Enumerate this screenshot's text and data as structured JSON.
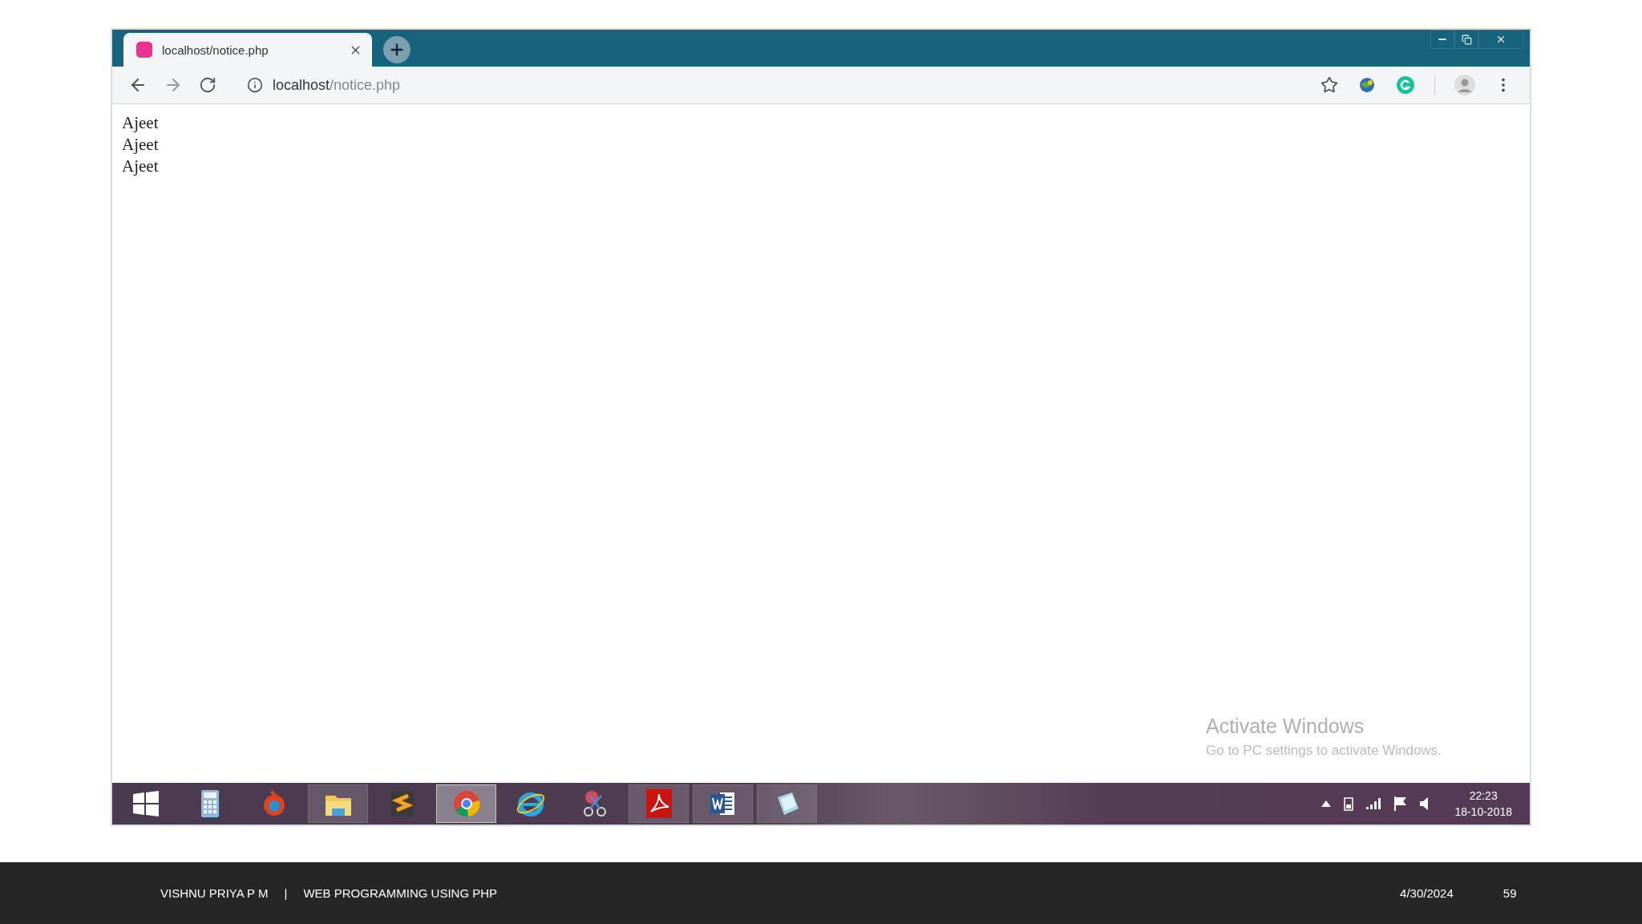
{
  "browser": {
    "tabs": [
      {
        "title": "localhost/notice.php",
        "selected": true
      }
    ],
    "address": {
      "host": "localhost",
      "path": "/notice.php"
    },
    "content_lines": [
      "Ajeet",
      "Ajeet",
      "Ajeet"
    ]
  },
  "activation_notice": {
    "title": "Activate Windows",
    "message": "Go to PC settings to activate Windows."
  },
  "taskbar": {
    "apps": [
      {
        "kind": "start",
        "open": false,
        "selected": false
      },
      {
        "kind": "calculator",
        "open": false,
        "selected": false
      },
      {
        "kind": "firefox",
        "open": false,
        "selected": false
      },
      {
        "kind": "explorer",
        "open": true,
        "selected": false
      },
      {
        "kind": "sublime",
        "open": false,
        "selected": false
      },
      {
        "kind": "chrome",
        "open": true,
        "selected": true
      },
      {
        "kind": "ie",
        "open": false,
        "selected": false
      },
      {
        "kind": "snipping",
        "open": false,
        "selected": false
      },
      {
        "kind": "acrobat",
        "open": true,
        "selected": false
      },
      {
        "kind": "word",
        "open": true,
        "selected": false
      },
      {
        "kind": "notepad",
        "open": true,
        "selected": false
      }
    ],
    "time": "22:23",
    "date": "18-10-2018"
  },
  "footer": {
    "author": "VISHNU PRIYA P M",
    "separator": "|",
    "course": "WEB PROGRAMMING USING PHP",
    "date": "4/30/2024",
    "page": "59"
  }
}
